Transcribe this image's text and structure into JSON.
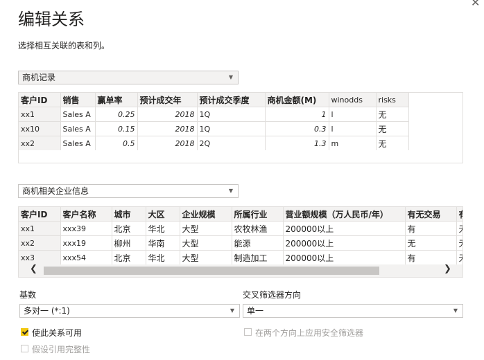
{
  "dialog": {
    "title": "编辑关系",
    "subtitle": "选择相互关联的表和列。"
  },
  "table1": {
    "selected": "商机记录",
    "columns": [
      "客户ID",
      "销售",
      "赢单率",
      "预计成交年",
      "预计成交季度",
      "商机金额(M)",
      "winodds",
      "risks"
    ],
    "rows": [
      [
        "xx1",
        "Sales A",
        "0.25",
        "2018",
        "1Q",
        "1",
        "l",
        "无"
      ],
      [
        "xx10",
        "Sales A",
        "0.15",
        "2018",
        "1Q",
        "0.3",
        "l",
        "无"
      ],
      [
        "xx2",
        "Sales A",
        "0.5",
        "2018",
        "2Q",
        "1.3",
        "m",
        "无"
      ]
    ]
  },
  "table2": {
    "selected": "商机相关企业信息",
    "columns": [
      "客户ID",
      "客户名称",
      "城市",
      "大区",
      "企业规模",
      "所属行业",
      "营业额规模（万人民币/年）",
      "有无交易",
      "有"
    ],
    "rows": [
      [
        "xx1",
        "xxx39",
        "北京",
        "华北",
        "大型",
        "农牧林渔",
        "200000以上",
        "有",
        "无"
      ],
      [
        "xx2",
        "xxx19",
        "柳州",
        "华南",
        "大型",
        "能源",
        "200000以上",
        "无",
        "无"
      ],
      [
        "xx3",
        "xxx54",
        "北京",
        "华北",
        "大型",
        "制造加工",
        "200000以上",
        "有",
        "无"
      ]
    ]
  },
  "cardinality": {
    "label": "基数",
    "value": "多对一 (*:1)"
  },
  "crossfilter": {
    "label": "交叉筛选器方向",
    "value": "单一"
  },
  "options": {
    "make_active": "使此关系可用",
    "security_filter": "在两个方向上应用安全筛选器",
    "referential_integrity": "假设引用完整性"
  },
  "colors": {
    "accent_checkbox": "#f2c811",
    "header_bg": "#f3f2f1",
    "border": "#e1dfdd"
  }
}
